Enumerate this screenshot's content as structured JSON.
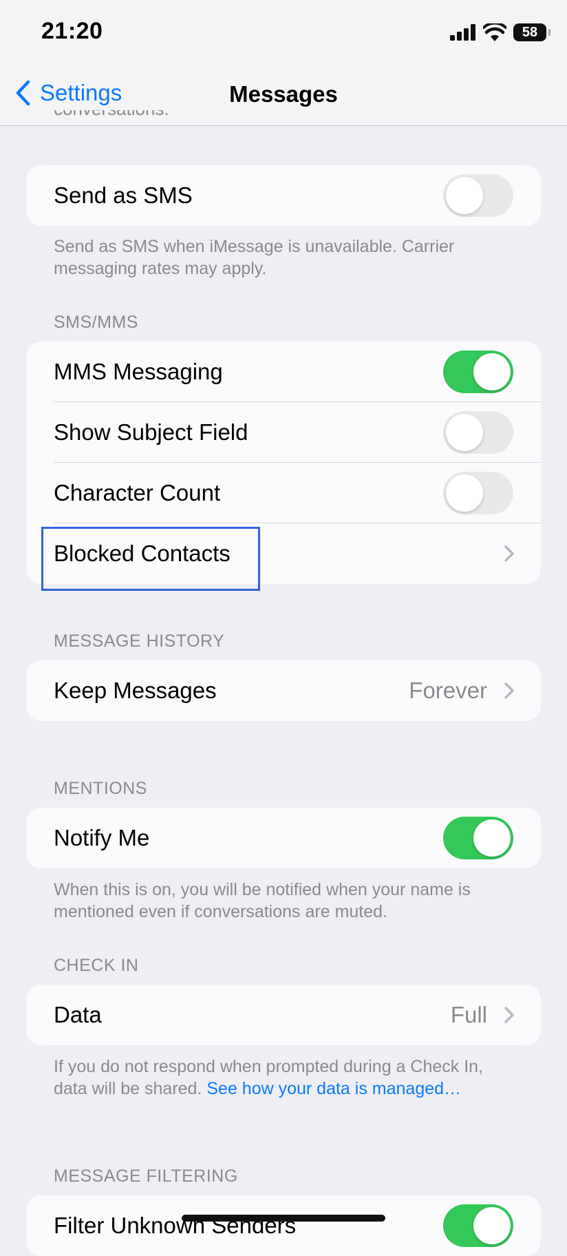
{
  "status_bar": {
    "time": "21:20",
    "battery": "58"
  },
  "nav": {
    "back_label": "Settings",
    "title": "Messages"
  },
  "clipped_footer": "conversations.",
  "send_as_sms": {
    "label": "Send as SMS",
    "on": false,
    "footer": "Send as SMS when iMessage is unavailable. Carrier messaging rates may apply."
  },
  "sms_mms": {
    "header": "SMS/MMS",
    "rows": [
      {
        "label": "MMS Messaging",
        "on": true
      },
      {
        "label": "Show Subject Field",
        "on": false
      },
      {
        "label": "Character Count",
        "on": false
      },
      {
        "label": "Blocked Contacts"
      }
    ]
  },
  "message_history": {
    "header": "MESSAGE HISTORY",
    "keep_label": "Keep Messages",
    "keep_value": "Forever"
  },
  "mentions": {
    "header": "MENTIONS",
    "label": "Notify Me",
    "on": true,
    "footer": "When this is on, you will be notified when your name is mentioned even if conversations are muted."
  },
  "check_in": {
    "header": "CHECK IN",
    "label": "Data",
    "value": "Full",
    "footer_text": "If you do not respond when prompted during a Check In, data will be shared. ",
    "footer_link": "See how your data is managed…"
  },
  "message_filtering": {
    "header": "MESSAGE FILTERING",
    "label": "Filter Unknown Senders",
    "on": true
  },
  "colors": {
    "accent": "#0a7aff",
    "toggle_on": "#34c759",
    "highlight": "#3363d6"
  }
}
